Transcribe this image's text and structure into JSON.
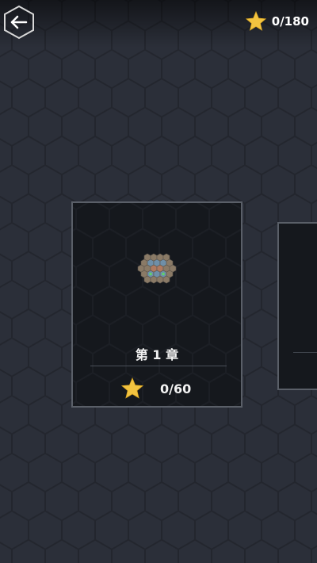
{
  "header": {
    "back_icon": "arrow-left-icon",
    "star_icon": "star-icon",
    "total_stars": "0/180"
  },
  "chapters": [
    {
      "title": "第 1 章",
      "stars": "0/60",
      "star_icon": "star-icon",
      "preview_icon": "hex-board-icon"
    },
    {
      "title": "",
      "stars": ""
    }
  ],
  "colors": {
    "background": "#2b2f39",
    "card_background": "#15181d",
    "card_border": "#5a5f68",
    "star": "#f2c340",
    "text": "#f2f2f2"
  }
}
